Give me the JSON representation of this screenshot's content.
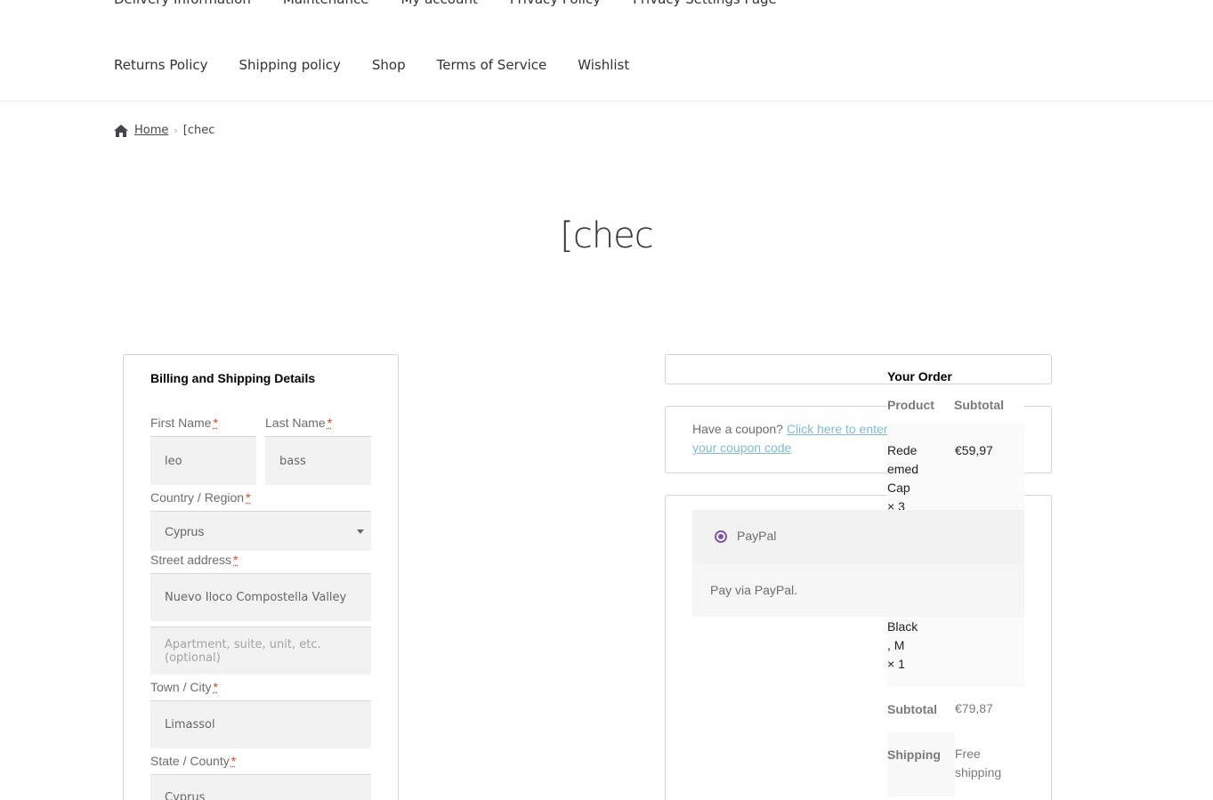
{
  "nav": {
    "top_items": [
      "Delivery Information",
      "Maintenance",
      "My account",
      "Privacy Policy",
      "Privacy Settings Page"
    ],
    "bottom_items": [
      "Returns Policy",
      "Shipping policy",
      "Shop",
      "Terms of Service",
      "Wishlist"
    ]
  },
  "breadcrumb": {
    "home": "Home",
    "current": "[chec"
  },
  "page_title": "[chec",
  "billing": {
    "heading": "Billing and Shipping Details",
    "required_mark": "*",
    "first_name_label": "First Name",
    "first_name_value": "leo",
    "last_name_label": "Last Name",
    "last_name_value": "bass",
    "country_label": "Country / Region",
    "country_value": "Cyprus",
    "street_label": "Street address",
    "street_value": "Nuevo Iloco Compostella Valley",
    "apartment_placeholder": "Apartment, suite, unit, etc. (optional)",
    "city_label": "Town / City",
    "city_value": "Limassol",
    "state_label": "State / County",
    "state_value": "Cyprus"
  },
  "coupon": {
    "prefix": "Have a coupon?",
    "link": "Click here to enter your coupon code"
  },
  "order": {
    "title": "Your Order",
    "col_product": "Product",
    "col_subtotal": "Subtotal",
    "item1_lines": [
      "Rede",
      "emed",
      "Cap",
      "× 3"
    ],
    "item1_price": "€59,97",
    "item2_lines": [
      "Black",
      ", M",
      "× 1"
    ],
    "subtotal_label": "Subtotal",
    "subtotal_value": "€79,87",
    "shipping_label": "Shipping",
    "shipping_value_lines": [
      "Free",
      "shipping"
    ]
  },
  "payment": {
    "method": "PayPal",
    "description": "Pay via PayPal.",
    "accent": "#7f54b3"
  }
}
